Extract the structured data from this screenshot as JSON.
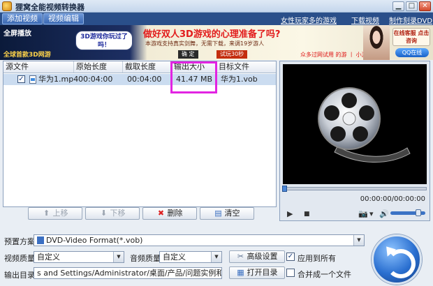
{
  "window": {
    "title": "狸窝全能视频转换器",
    "controls": {
      "minimize": "▁",
      "maximize": "□",
      "close": "✕"
    }
  },
  "menubar": {
    "add_video": "添加视频",
    "edit_video": "视频编辑",
    "links": [
      "女性玩家多的游戏",
      "下载视频",
      "制作刻录DVD"
    ]
  },
  "banner": {
    "fullscreen": "全屏播放",
    "left_tag": "全球首款3D网游",
    "bubble": "3D游戏你玩过了吗！",
    "headline": "做好双人3D游戏的心理准备了吗?",
    "sub": "本游戏支持真实剑舞，无需下载，来调19岁游人",
    "btn_confirm": "确 定",
    "btn_trial": "试玩30秒",
    "note": "众多过网试用 的游 丨 小游戏娱",
    "kefu": "在线客服 点击咨询",
    "qq": "QQ在线"
  },
  "file_list": {
    "columns": [
      "源文件",
      "原始长度",
      "截取长度",
      "输出大小",
      "目标文件"
    ],
    "rows": [
      {
        "checked": "✓",
        "source": "华为1.mp4",
        "original_length": "00:04:00",
        "clip_length": "00:04:00",
        "output_size": "41.47 MB",
        "target": "华为1.vob"
      }
    ]
  },
  "list_buttons": {
    "up": "上移",
    "down": "下移",
    "delete": "删除",
    "clear": "清空"
  },
  "player": {
    "time": "00:00:00/00:00:00",
    "play": "▶",
    "stop": "■",
    "snapshot": "📷",
    "snapshot_menu": "▾",
    "volume_icon": "🔊",
    "volume_level": 0.85,
    "seek_position": 0.0
  },
  "settings": {
    "preset_label": "预置方案:",
    "preset_value": "DVD-Video Format(*.vob)",
    "video_quality_label": "视频质量:",
    "video_quality_value": "自定义",
    "audio_quality_label": "音频质量:",
    "audio_quality_value": "自定义",
    "advanced_button": "高级设置",
    "apply_all_label": "应用到所有",
    "apply_all_checked": "✓",
    "output_dir_label": "输出目录:",
    "output_dir_value": "s and Settings/Administrator/桌面/产品/问题实例和视频原件/转换",
    "open_dir_button": "打开目录",
    "merge_label": "合并成一个文件",
    "merge_checked": ""
  }
}
